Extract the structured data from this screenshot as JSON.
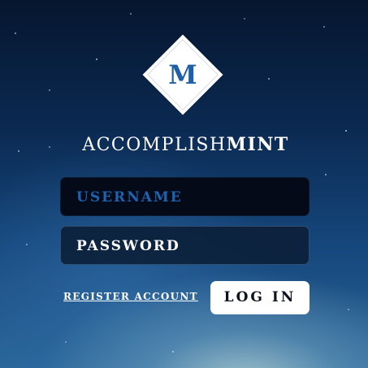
{
  "logo": {
    "letter": "M"
  },
  "brand": {
    "name_light": "ACCOMPLISH",
    "name_bold": "MINT"
  },
  "form": {
    "username_placeholder": "USERNAME",
    "password_placeholder": "PASSWORD",
    "register_label": "REGISTER ACCOUNT",
    "login_label": "LOG IN"
  }
}
